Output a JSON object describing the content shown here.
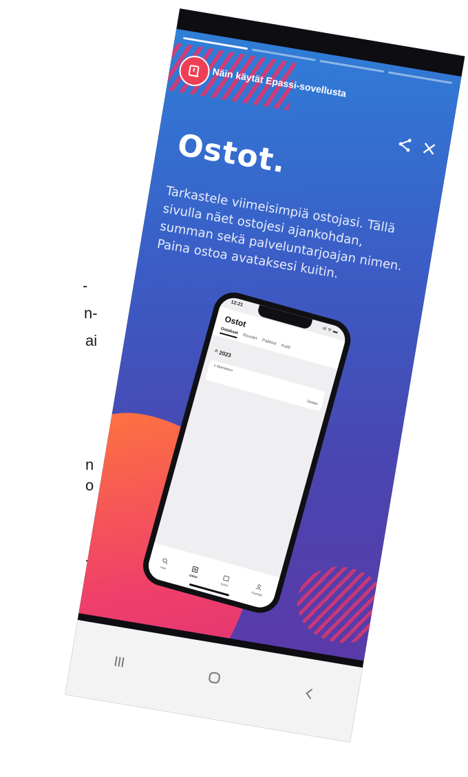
{
  "background_page": {
    "fragments": [
      "-",
      "n-",
      "ai",
      "n",
      "o",
      "-"
    ]
  },
  "story": {
    "progress_segments": 4,
    "progress_active": 1,
    "account_name": "Näin käytät Epassi-sovellusta",
    "title": "Ostot.",
    "body": "Tarkastele viimeisimpiä ostojasi. Tällä sivulla näet ostojesi ajankohdan, summan sekä palveluntarjoajan nimen. Paina ostoa avataksesi kuitin.",
    "colors": {
      "gradient_top": "#2f7fd8",
      "gradient_bottom": "#5a3aa8",
      "blob": "#ef3f6a",
      "stripes": "#e0366d",
      "avatar": "#ef3f55"
    },
    "icons": [
      "share-icon",
      "close-icon",
      "avatar-book-icon"
    ]
  },
  "mini_app": {
    "time": "12:21",
    "status": "ııl ᯤ ▬",
    "title": "Ostot",
    "tabs": [
      "Ostokset",
      "Etuudet",
      "Palkkiot",
      "Kuitit"
    ],
    "active_tab": 0,
    "year": "^ 2023",
    "month_label": "∨ Marraskuu",
    "month_value": "Tänään",
    "nav": [
      "Hae",
      "Ostot",
      "Saldo",
      "Käyttäjä"
    ],
    "nav_active": 1
  },
  "system_nav": {
    "icons": [
      "recent-apps-icon",
      "home-icon",
      "back-icon"
    ]
  }
}
